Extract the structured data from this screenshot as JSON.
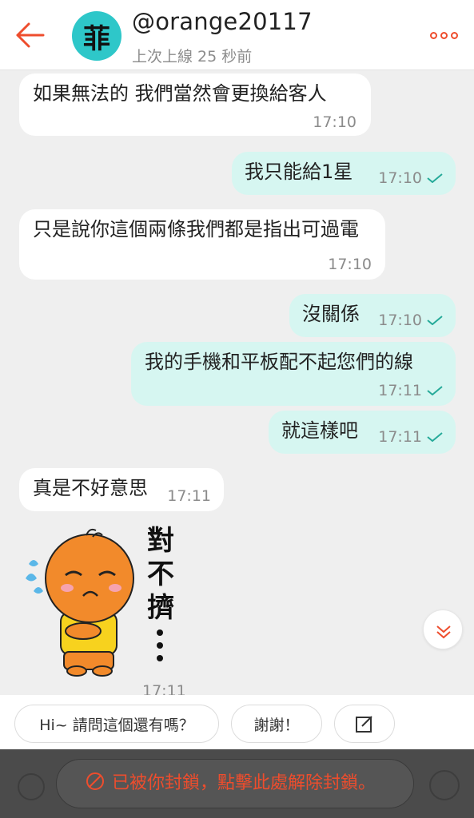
{
  "header": {
    "username": "@orange20117",
    "last_seen": "上次上線 25 秒前",
    "avatar_text": "菲"
  },
  "messages": [
    {
      "text": "如果無法的 我們當然會更換給客人",
      "time": "17:10"
    },
    {
      "text": "我只能給1星",
      "time": "17:10"
    },
    {
      "text": "只是說你這個兩條我們都是指出可過電",
      "time": "17:10"
    },
    {
      "text": "沒關係",
      "time": "17:10"
    },
    {
      "text": "我的手機和平板配不起您們的線",
      "time": "17:11"
    },
    {
      "text": "就這樣吧",
      "time": "17:11"
    },
    {
      "text": "真是不好意思",
      "time": "17:11"
    }
  ],
  "sticker": {
    "text": "對不擠…",
    "time": "17:11"
  },
  "quick_replies": [
    "Hi~ 請問這個還有嗎？",
    "謝謝！"
  ],
  "blocked_notice": "已被你封鎖，點擊此處解除封鎖。",
  "colors": {
    "accent": "#ee4d2d",
    "outgoing_bubble": "#d6f6f1",
    "incoming_bubble": "#ffffff",
    "tick": "#26aa99"
  },
  "icons": [
    "back-arrow-icon",
    "more-icon",
    "double-chevron-down-icon",
    "edit-icon",
    "blocked-icon",
    "plus-icon",
    "emoji-icon"
  ]
}
